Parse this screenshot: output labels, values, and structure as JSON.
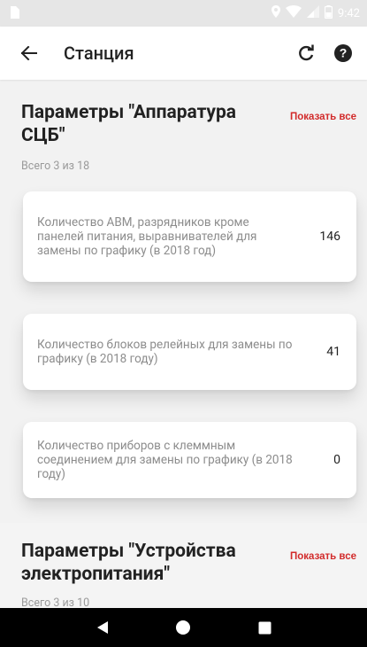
{
  "status_bar": {
    "time": "9:42"
  },
  "toolbar": {
    "title": "Станция"
  },
  "sections": [
    {
      "title": "Параметры \"Аппаратура СЦБ\"",
      "show_all": "Показать все",
      "subtitle": "Всего 3 из 18",
      "items": [
        {
          "label": "Количество АВМ, разрядников кроме панелей питания, выравнивателей для замены по графику (в 2018 год)",
          "value": "146"
        },
        {
          "label": "Количество блоков релейных для замены по графику (в 2018 году)",
          "value": "41"
        },
        {
          "label": "Количество приборов с клеммным соединением для замены по графику (в 2018 году)",
          "value": "0"
        }
      ]
    },
    {
      "title": "Параметры \"Устройства электропитания\"",
      "show_all": "Показать все",
      "subtitle": "Всего 3 из 10"
    }
  ],
  "colors": {
    "accent": "#d22b2b",
    "background": "#f2f2f2",
    "card": "#ffffff",
    "navbar": "#000000"
  }
}
